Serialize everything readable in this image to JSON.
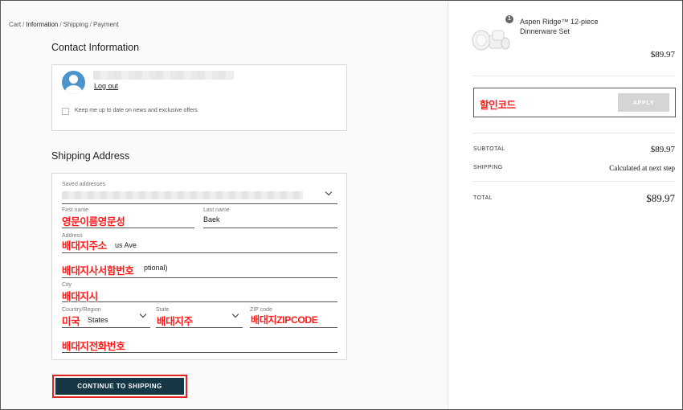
{
  "breadcrumb": {
    "cart": "Cart",
    "information": "Information",
    "shipping": "Shipping",
    "payment": "Payment",
    "separator": "/"
  },
  "contact": {
    "title": "Contact Information",
    "logout": "Log out",
    "newsletter_label": "Keep me up to date on news and exclusive offers"
  },
  "shipping": {
    "title": "Shipping Address",
    "saved_addresses_label": "Saved addresses",
    "first_name_label": "First name",
    "last_name_label": "Last name",
    "last_name_value": "Baek",
    "address_label": "Address",
    "address_value_fragment": "us Ave",
    "apartment_value_fragment": "ptional)",
    "city_label": "City",
    "country_label": "Country/Region",
    "country_value_fragment": "States",
    "state_label": "State",
    "zip_label": "ZIP code"
  },
  "annotations": {
    "first_name": "영문이름영문성",
    "address": "배대지주소",
    "apartment": "배대지사서함번호",
    "city": "배대지시",
    "country": "미국",
    "state": "배대지주",
    "zip": "배대지ZIPCODE",
    "phone": "배대지전화번호",
    "discount": "할인코드"
  },
  "buttons": {
    "continue": "CONTINUE TO SHIPPING",
    "apply": "APPLY"
  },
  "order": {
    "quantity": "1",
    "product_name": "Aspen Ridge™ 12-piece Dinnerware Set",
    "product_price": "$89.97",
    "subtotal_label": "SUBTOTAL",
    "subtotal_value": "$89.97",
    "shipping_label": "SHIPPING",
    "shipping_value": "Calculated at next step",
    "total_label": "TOTAL",
    "total_value": "$89.97"
  },
  "colors": {
    "primary_button": "#163746",
    "annotation_red": "#ff1a1a",
    "avatar_blue": "#4d93cc"
  }
}
